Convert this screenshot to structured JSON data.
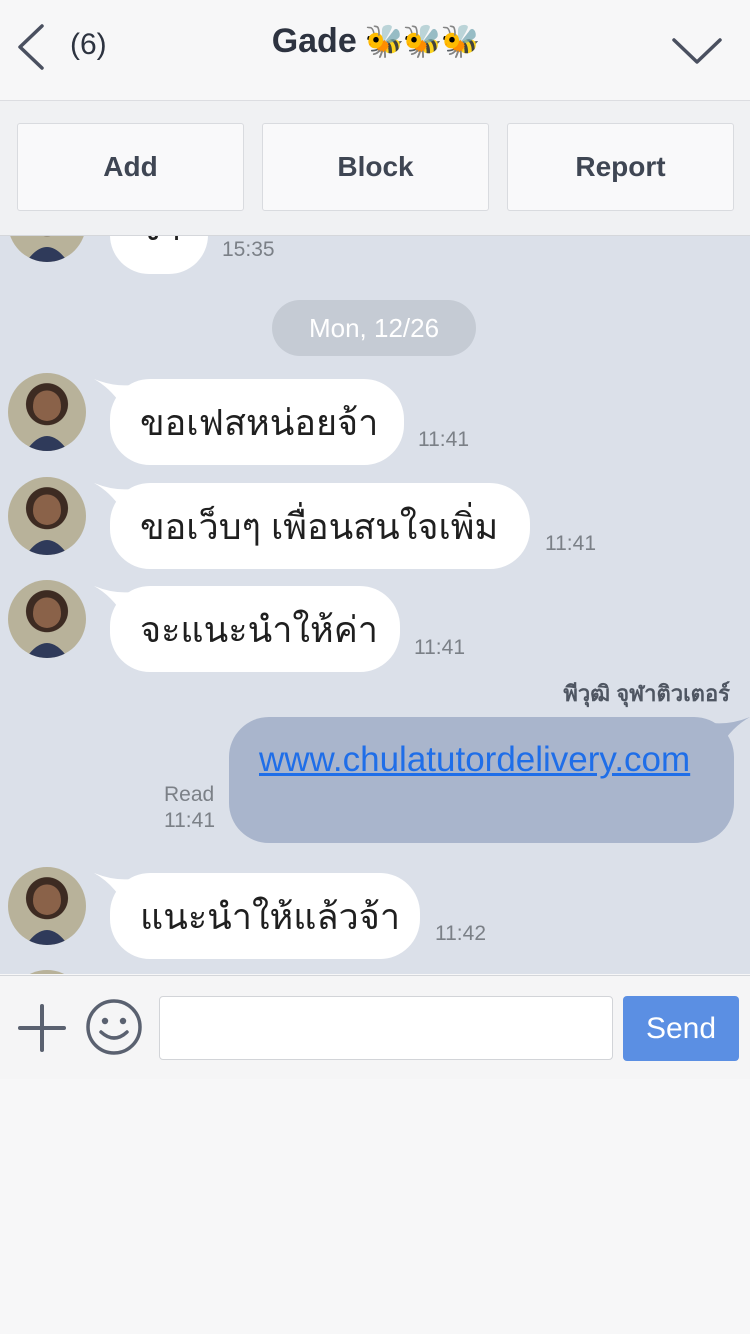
{
  "header": {
    "unread_count": "(6)",
    "title": "Gade",
    "title_emoji": "🐝🐝🐝"
  },
  "actions": {
    "add_label": "Add",
    "block_label": "Block",
    "report_label": "Report"
  },
  "chat": {
    "top_partial_message": {
      "text": "จ้า",
      "time": "15:35"
    },
    "date_separator": "Mon, 12/26",
    "incoming": [
      {
        "text": "ขอเฟสหน่อยจ้า",
        "time": "11:41"
      },
      {
        "text": "ขอเว็บๆ เพื่อนสนใจเพิ่ม",
        "time": "11:41"
      },
      {
        "text": "จะแนะนำให้ค่า",
        "time": "11:41"
      }
    ],
    "outgoing_sender": "พีวุฒิ จุฬาติวเตอร์",
    "outgoing": {
      "text": "www.chulatutordelivery.com",
      "read_label": "Read",
      "time": "11:41"
    },
    "incoming_last": {
      "text": "แนะนำให้แล้วจ้า",
      "time": "11:42"
    }
  },
  "input_bar": {
    "message_value": "",
    "send_label": "Send"
  },
  "icons": [
    "back-icon",
    "chevron-down-icon",
    "plus-icon",
    "smile-icon"
  ],
  "colors": {
    "chat_background": "#dbe0e9",
    "outgoing_bubble": "#a9b5cc",
    "send_button": "#5b8fe3",
    "link": "#1f6ee8"
  }
}
